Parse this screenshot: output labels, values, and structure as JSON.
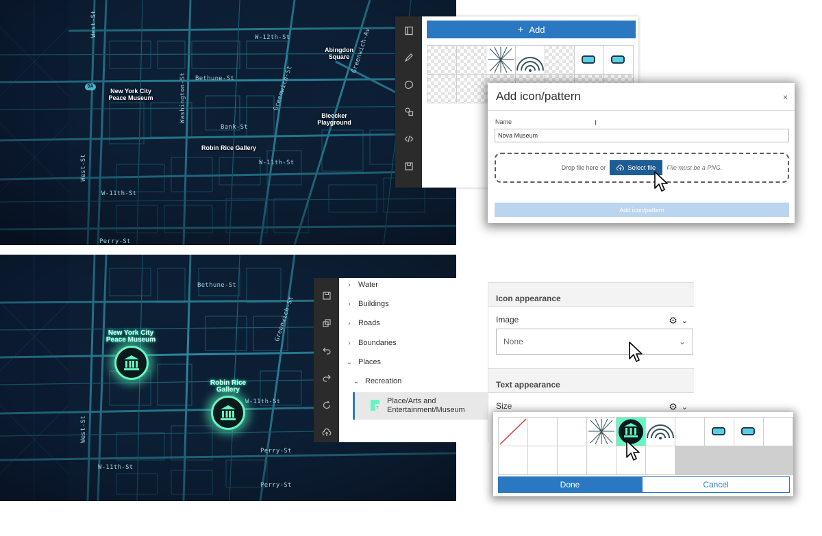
{
  "maps": {
    "streets": [
      "W-12th-St",
      "Bethune-St",
      "Bank-St",
      "W-11th-St",
      "W-11th-St",
      "Perry-St",
      "Washington-St",
      "Greenwich-St",
      "Greenwich-Av",
      "West-St",
      "West-St",
      "Bethune-St",
      "W-11th-St",
      "Perry-St",
      "Greenwich-St",
      "West-St",
      "W-11th-St",
      "Perry-St"
    ],
    "route_badge": "9A",
    "places_top": {
      "abingdon": "Abingdon Square",
      "bleecker": "Bleecker Playground",
      "peace_museum": "New York City Peace Museum",
      "gallery": "Robin Rice Gallery"
    },
    "places_bottom": {
      "peace_museum": "New York City Peace Museum",
      "gallery": "Robin Rice Gallery"
    }
  },
  "top_panel": {
    "add_label": "Add",
    "toolbar_icons": [
      "book-icon",
      "pen-icon",
      "palette-icon",
      "shapes-icon",
      "code-icon",
      "save-icon"
    ]
  },
  "dialog": {
    "title": "Add icon/pattern",
    "close": "×",
    "name_label": "Name",
    "name_value": "Nova Museum",
    "drop_text": "Drop file here or",
    "select_file": "Select file",
    "file_hint": "File must be a PNG.",
    "submit": "Add icon/pattern"
  },
  "tree": {
    "items": [
      {
        "label": "Water",
        "chevron": "›"
      },
      {
        "label": "Buildings",
        "chevron": "›"
      },
      {
        "label": "Roads",
        "chevron": "›"
      },
      {
        "label": "Boundaries",
        "chevron": "›"
      },
      {
        "label": "Places",
        "chevron": "⌄"
      },
      {
        "label": "Recreation",
        "chevron": "⌄"
      }
    ],
    "selected": "Place/Arts and Entertainment/Museum",
    "toolbar_icons": [
      "save-icon",
      "copy-icon",
      "undo-icon",
      "redo-icon",
      "reset-icon",
      "upload-icon"
    ]
  },
  "properties": {
    "icon_section": "Icon appearance",
    "image_label": "Image",
    "image_value": "None",
    "text_section": "Text appearance",
    "size_label": "Size"
  },
  "picker": {
    "done": "Done",
    "cancel": "Cancel"
  },
  "colors": {
    "accent": "#2a78c2",
    "map_bg": "#0c1d33",
    "map_line": "#1f6f84",
    "glow": "#66f5c2"
  }
}
